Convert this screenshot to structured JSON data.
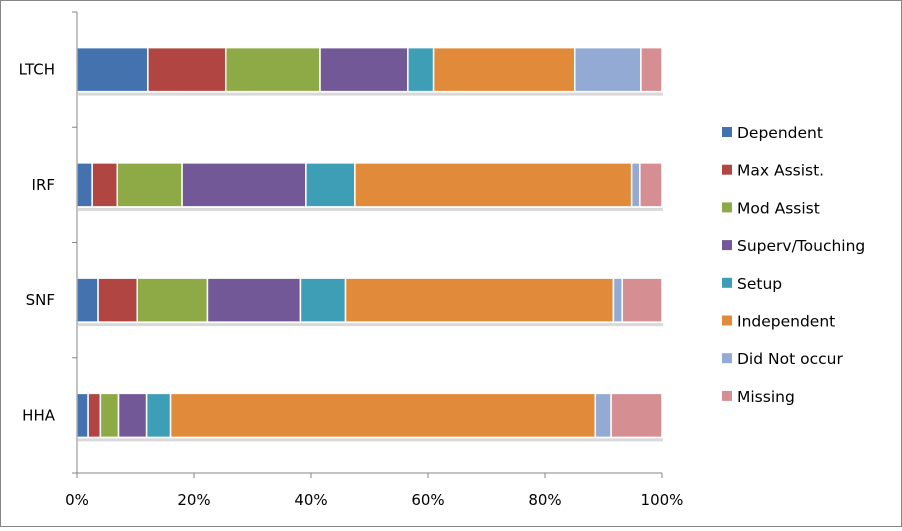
{
  "chart_data": {
    "type": "bar",
    "orientation": "horizontal",
    "stacked": "percent",
    "title": "",
    "xlabel": "",
    "ylabel": "",
    "xlim": [
      0,
      100
    ],
    "x_ticks": [
      "0%",
      "20%",
      "40%",
      "60%",
      "80%",
      "100%"
    ],
    "grid": false,
    "legend_position": "right",
    "categories": [
      "LTCH",
      "IRF",
      "SNF",
      "HHA"
    ],
    "series": [
      {
        "name": "Dependent",
        "color": "#4372AE",
        "values": [
          12.1,
          2.6,
          3.6,
          1.9
        ]
      },
      {
        "name": "Max Assist.",
        "color": "#B04541",
        "values": [
          13.3,
          4.3,
          6.7,
          2.1
        ]
      },
      {
        "name": "Mod Assist",
        "color": "#8DAA47",
        "values": [
          16.1,
          11.1,
          12.0,
          3.1
        ]
      },
      {
        "name": "Superv/Touching",
        "color": "#735897",
        "values": [
          15.0,
          21.2,
          15.9,
          4.8
        ]
      },
      {
        "name": "Setup",
        "color": "#3D9EB5",
        "values": [
          4.4,
          8.4,
          7.7,
          4.1
        ]
      },
      {
        "name": "Independent",
        "color": "#E18A3A",
        "values": [
          24.1,
          47.4,
          45.8,
          72.6
        ]
      },
      {
        "name": "Did Not occur",
        "color": "#93AAD4",
        "values": [
          11.3,
          1.4,
          1.5,
          2.7
        ]
      },
      {
        "name": "Missing",
        "color": "#D58F92",
        "values": [
          3.6,
          3.8,
          6.8,
          8.7
        ]
      }
    ]
  }
}
